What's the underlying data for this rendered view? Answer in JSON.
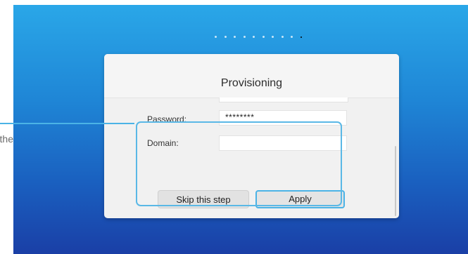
{
  "background": {
    "gradient_top": "#2aa7e8",
    "gradient_bottom": "#1a3fa6",
    "accent": "#4bb3e6"
  },
  "outside": {
    "partial_text": "the"
  },
  "progress": {
    "total_steps": 10,
    "active_step": 10
  },
  "dialog": {
    "title": "Provisioning",
    "fields": {
      "password": {
        "label": "Password:",
        "value": "********"
      },
      "domain": {
        "label": "Domain:",
        "value": "",
        "placeholder": ""
      }
    },
    "buttons": {
      "skip_label": "Skip this step",
      "apply_label": "Apply"
    }
  }
}
